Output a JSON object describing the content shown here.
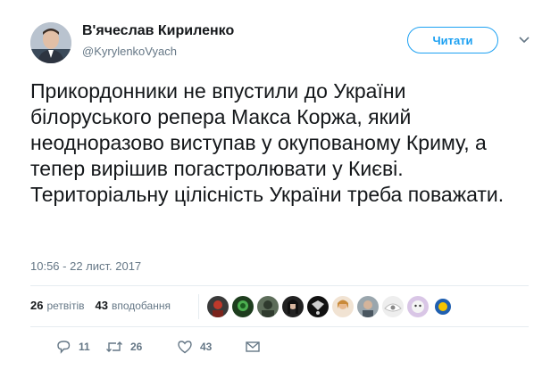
{
  "author": {
    "name": "В'ячеслав Кириленко",
    "handle": "@KyrylenkoVyach",
    "avatar_icon": "profile-photo"
  },
  "follow_button": {
    "label": "Читати",
    "color": "#1da1f2"
  },
  "tweet": {
    "text": "Прикордонники не впустили до України білоруського репера Макса Коржа, який неодноразово виступав у окупованому Криму, а тепер вирішив погастролювати у Києві. Територіальну цілісність України треба поважати.",
    "timestamp": "10:56 - 22 лист. 2017"
  },
  "stats": {
    "retweets_count": "26",
    "retweets_label": "ретвітів",
    "likes_count": "43",
    "likes_label": "вподобання"
  },
  "actions": {
    "reply_count": "11",
    "retweet_count": "26",
    "like_count": "43"
  },
  "colors": {
    "text": "#14171a",
    "muted": "#657786",
    "accent": "#1da1f2",
    "divider": "#e6ecf0"
  }
}
